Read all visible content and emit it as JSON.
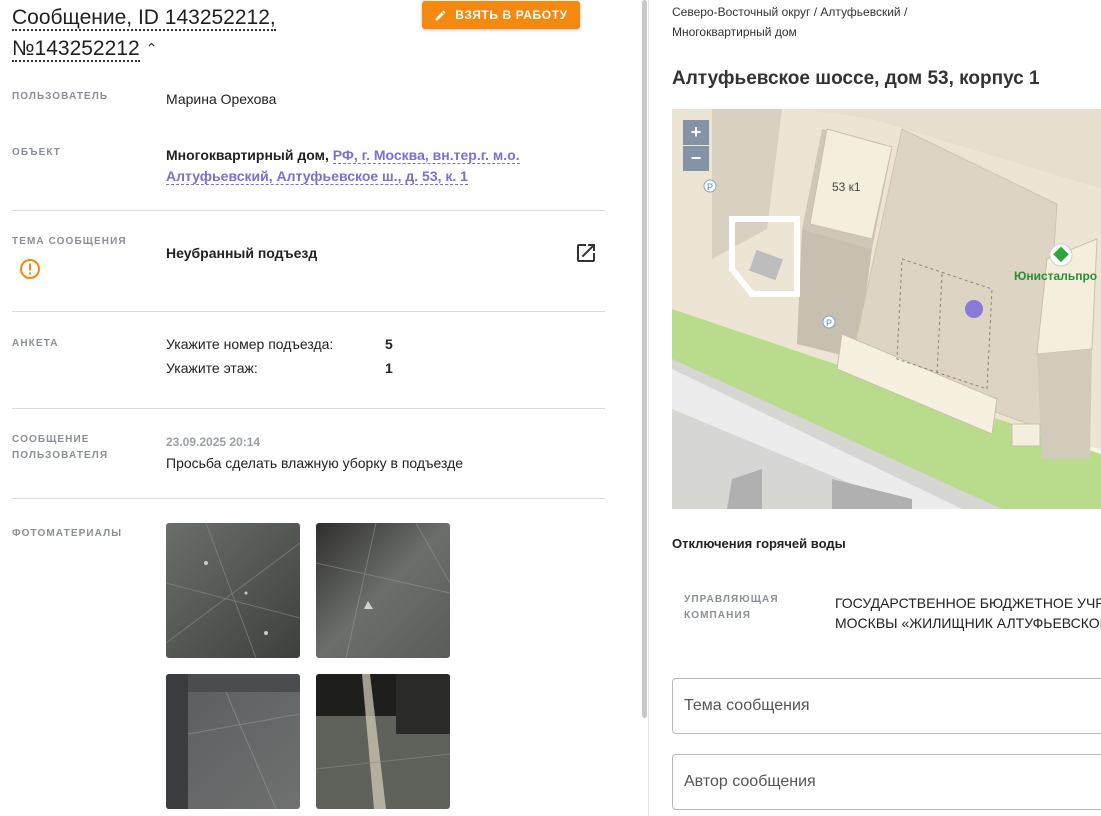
{
  "header": {
    "title_line1": "Сообщение, ID 143252212,",
    "title_line2": "№143252212",
    "take_button": "ВЗЯТЬ В РАБОТУ"
  },
  "details": {
    "user_label": "ПОЛЬЗОВАТЕЛЬ",
    "user_value": "Марина Орехова",
    "object_label": "ОБЪЕКТ",
    "object_type": "Многоквартирный дом,",
    "object_link": "РФ, г. Москва, вн.тер.г. м.о. Алтуфьевский, Алтуфьевское ш., д. 53, к. 1",
    "topic_label": "ТЕМА СООБЩЕНИЯ",
    "topic_value": "Неубранный подъезд",
    "anketa_label": "АНКЕТА",
    "anketa": [
      {
        "q": "Укажите номер подъезда:",
        "a": "5"
      },
      {
        "q": "Укажите этаж:",
        "a": "1"
      }
    ],
    "msg_label": "СООБЩЕНИЕ ПОЛЬЗОВАТЕЛЯ",
    "msg_date": "23.09.2025 20:14",
    "msg_text": "Просьба сделать влажную уборку в подъезде",
    "photos_label": "ФОТОМАТЕРИАЛЫ"
  },
  "right": {
    "breadcrumb": "Северо-Восточный округ / Алтуфьевский / Многоквартирный дом",
    "address": "Алтуфьевское шоссе, дом 53, корпус 1",
    "map": {
      "zoom_in": "+",
      "zoom_out": "−",
      "building_label": "53 к1",
      "poi_label": "Юнистальпро"
    },
    "hot_water": "Отключения горячей воды",
    "uk_label": "УПРАВЛЯЮЩАЯ КОМПАНИЯ",
    "uk_value_line1": "ГОСУДАРСТВЕННОЕ БЮДЖЕТНОЕ УЧРЕЖ",
    "uk_value_line2": "МОСКВЫ «ЖИЛИЩНИК АЛТУФЬЕВСКОГО",
    "topic_placeholder": "Тема сообщения",
    "author_placeholder": "Автор сообщения"
  },
  "colors": {
    "accent_orange": "#f5880f",
    "link_purple": "#7b6fd0",
    "map_marker": "#8a7ad8"
  },
  "icons": [
    "pencil-icon",
    "chevron-up-icon",
    "warning-icon",
    "external-link-icon"
  ]
}
